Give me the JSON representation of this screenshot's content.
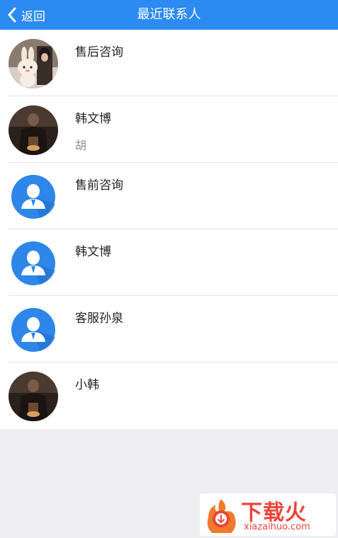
{
  "header": {
    "back_label": "返回",
    "title": "最近联系人"
  },
  "contacts": [
    {
      "name": "售后咨询",
      "sub": "",
      "avatar": "photo-avatar-bunny"
    },
    {
      "name": "韩文博",
      "sub": "胡",
      "avatar": "photo-avatar-man"
    },
    {
      "name": "售前咨询",
      "sub": "",
      "avatar": "default-user-icon"
    },
    {
      "name": "韩文博",
      "sub": "",
      "avatar": "default-user-icon"
    },
    {
      "name": "客服孙泉",
      "sub": "",
      "avatar": "default-user-icon"
    },
    {
      "name": "小韩",
      "sub": "",
      "avatar": "photo-avatar-man"
    }
  ],
  "watermark": {
    "title": "下载火",
    "url": "xiazaihuo.com"
  },
  "colors": {
    "nav_bar": "#2c8bf0",
    "default_avatar": "#2e86e8",
    "watermark": "#e8463b"
  }
}
